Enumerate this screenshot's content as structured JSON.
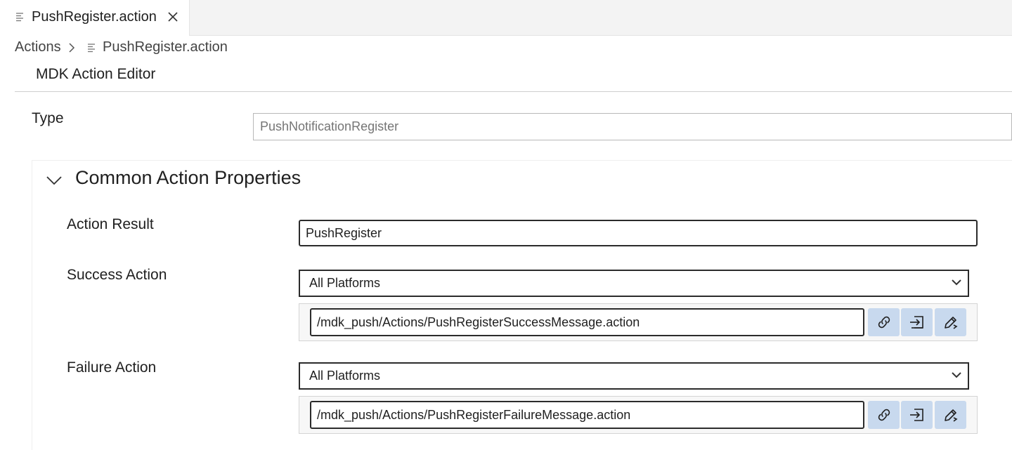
{
  "tab": {
    "label": "PushRegister.action",
    "file_icon": "file-lines-icon",
    "close_icon": "close-icon"
  },
  "breadcrumb": {
    "root": "Actions",
    "file": "PushRegister.action"
  },
  "editor": {
    "title": "MDK Action Editor"
  },
  "type": {
    "label": "Type",
    "placeholder": "PushNotificationRegister"
  },
  "section": {
    "title": "Common Action Properties",
    "expanded": true,
    "action_result": {
      "label": "Action Result",
      "value": "PushRegister"
    },
    "success_action": {
      "label": "Success Action",
      "platform": "All Platforms",
      "path": "/mdk_push/Actions/PushRegisterSuccessMessage.action"
    },
    "failure_action": {
      "label": "Failure Action",
      "platform": "All Platforms",
      "path": "/mdk_push/Actions/PushRegisterFailureMessage.action"
    }
  },
  "icons": [
    "link-icon",
    "insert-icon",
    "edit-pencil-icon"
  ],
  "colors": {
    "button_bg": "#c8d9ee",
    "border_dark": "#2b2b2b",
    "placeholder": "#9a9a9a"
  }
}
